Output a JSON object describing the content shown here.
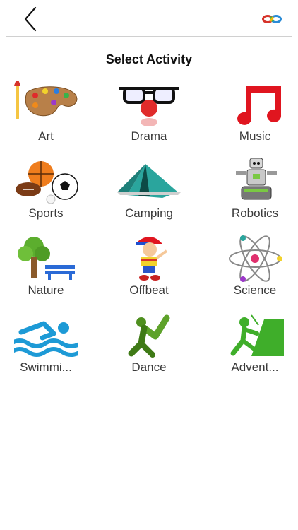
{
  "header": {
    "back_icon": "chevron-left-icon",
    "brand_icon": "infinity-icon",
    "brand_colors": [
      "#d6332a",
      "#f2b705",
      "#2a8bd6",
      "#39b54a"
    ]
  },
  "page": {
    "title": "Select Activity"
  },
  "activities": [
    {
      "label": "Art",
      "icon": "palette-icon"
    },
    {
      "label": "Drama",
      "icon": "clown-glasses-icon"
    },
    {
      "label": "Music",
      "icon": "music-note-icon"
    },
    {
      "label": "Sports",
      "icon": "sports-balls-icon"
    },
    {
      "label": "Camping",
      "icon": "tent-icon"
    },
    {
      "label": "Robotics",
      "icon": "robot-icon"
    },
    {
      "label": "Nature",
      "icon": "tree-bench-icon"
    },
    {
      "label": "Offbeat",
      "icon": "boy-character-icon"
    },
    {
      "label": "Science",
      "icon": "atom-icon"
    },
    {
      "label": "Swimmi...",
      "icon": "swimmer-icon"
    },
    {
      "label": "Dance",
      "icon": "dancer-icon"
    },
    {
      "label": "Advent...",
      "icon": "climber-icon"
    }
  ]
}
